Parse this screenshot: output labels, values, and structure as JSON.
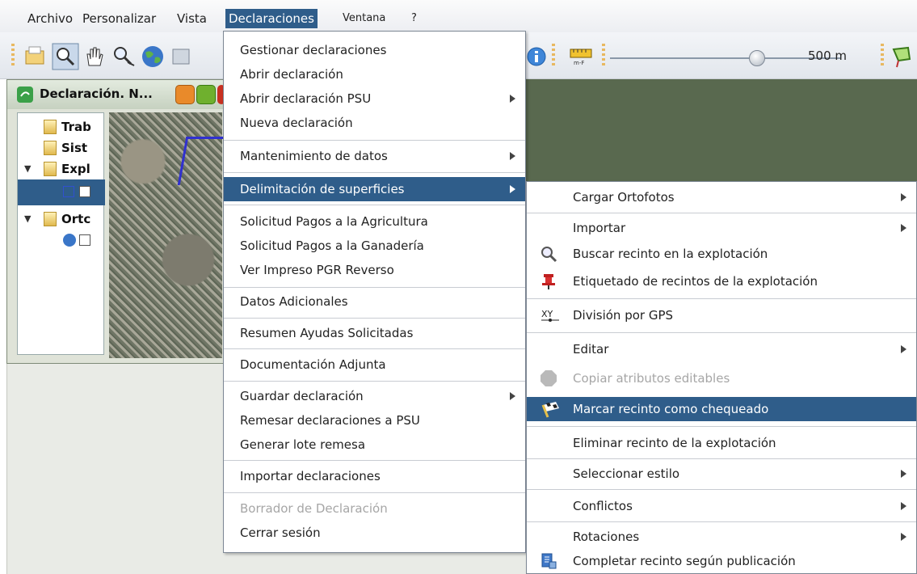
{
  "menubar": {
    "items": [
      "Archivo",
      "Personalizar",
      "Vista",
      "Declaraciones",
      "Ventana",
      "?"
    ]
  },
  "toolbar": {
    "zoom_label": "500 m",
    "scale_icon_label": "m-F"
  },
  "frame": {
    "title": "Declaración. N..."
  },
  "tree": {
    "rows": [
      "Trab",
      "Sist",
      "Expl",
      "",
      "Ortc",
      ""
    ]
  },
  "declaraciones_menu": {
    "items": [
      "Gestionar declaraciones",
      "Abrir declaración",
      "Abrir declaración PSU",
      "Nueva declaración",
      "Mantenimiento de datos",
      "Delimitación de superficies",
      "Solicitud Pagos a la Agricultura",
      "Solicitud Pagos a la Ganadería",
      "Ver Impreso PGR Reverso",
      "Datos Adicionales",
      "Resumen Ayudas Solicitadas",
      "Documentación Adjunta",
      "Guardar declaración",
      "Remesar declaraciones a PSU",
      "Generar lote remesa",
      "Importar declaraciones",
      "Borrador de Declaración",
      "Cerrar sesión"
    ]
  },
  "delimitacion_submenu": {
    "items": [
      "Cargar Ortofotos",
      "Importar",
      "Buscar recinto en la explotación",
      "Etiquetado de recintos de la explotación",
      "División por GPS",
      "Editar",
      "Copiar atributos editables",
      "Marcar recinto como chequeado",
      "Eliminar recinto de la explotación",
      "Seleccionar estilo",
      "Conflictos",
      "Rotaciones",
      "Completar recinto según publicación"
    ],
    "gps_icon_label": "XY"
  },
  "colors": {
    "highlight": "#2f5d8a",
    "workspace": "#59694f"
  }
}
